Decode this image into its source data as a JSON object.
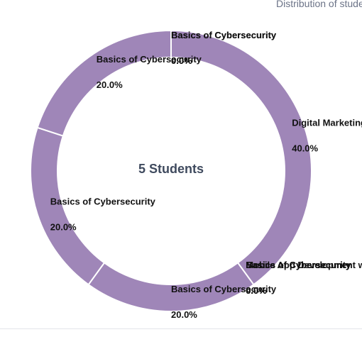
{
  "subtitle": "Distribution of students",
  "colors": {
    "segment_fill": "#9f86b8",
    "segment_border": "#ffffff",
    "center_text": "#3f4a5e"
  },
  "chart_data": {
    "type": "pie",
    "variant": "donut",
    "center_label": "5 Students",
    "slices": [
      {
        "label": "Digital Marketing Essentials",
        "value": 40.0,
        "value_label": "40.0%"
      },
      {
        "label": "Mobile App Development with React Native",
        "value": 0.0,
        "value_label": "0.0%"
      },
      {
        "label": "Basics of Cybersecurity",
        "value": 0.0,
        "value_label": "0.0%"
      },
      {
        "label": "Basics of Cybersecurity",
        "value": 0.0,
        "value_label": "0.0%"
      },
      {
        "label": "Basics of Cybersecurity",
        "value": 0.0,
        "value_label": "0.0%"
      },
      {
        "label": "Basics of Cybersecurity",
        "value": 20.0,
        "value_label": "20.0%"
      },
      {
        "label": "Basics of Cybersecurity",
        "value": 20.0,
        "value_label": "20.0%"
      },
      {
        "label": "Basics of Cybersecurity",
        "value": 20.0,
        "value_label": "20.0%"
      },
      {
        "label": "Basics of Cybersecurity",
        "value": 0.0,
        "value_label": "0.0%"
      },
      {
        "label": "Basics of Cybersecurity",
        "value": 0.0,
        "value_label": "0.0%"
      }
    ]
  }
}
